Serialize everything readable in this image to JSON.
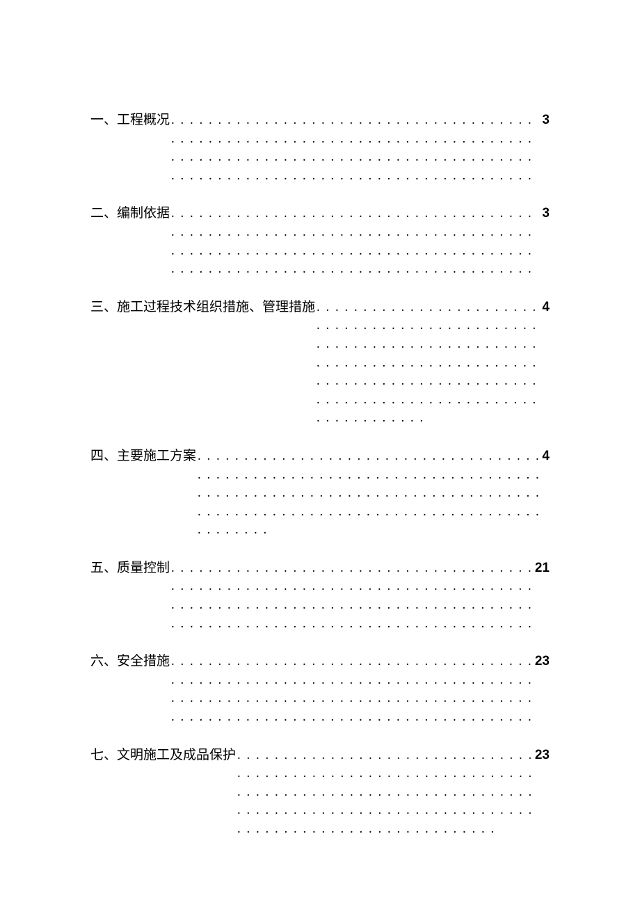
{
  "toc": {
    "entries": [
      {
        "title": "一、工程概况",
        "page": "3"
      },
      {
        "title": "二、编制依据",
        "page": "3"
      },
      {
        "title": "三、施工过程技术组织措施、管理措施",
        "page": "4"
      },
      {
        "title": "四、主要施工方案",
        "page": "4"
      },
      {
        "title": "五、质量控制",
        "page": "21"
      },
      {
        "title": "六、安全措施",
        "page": "23"
      },
      {
        "title": "七、文明施工及成品保护",
        "page": "23"
      }
    ]
  }
}
